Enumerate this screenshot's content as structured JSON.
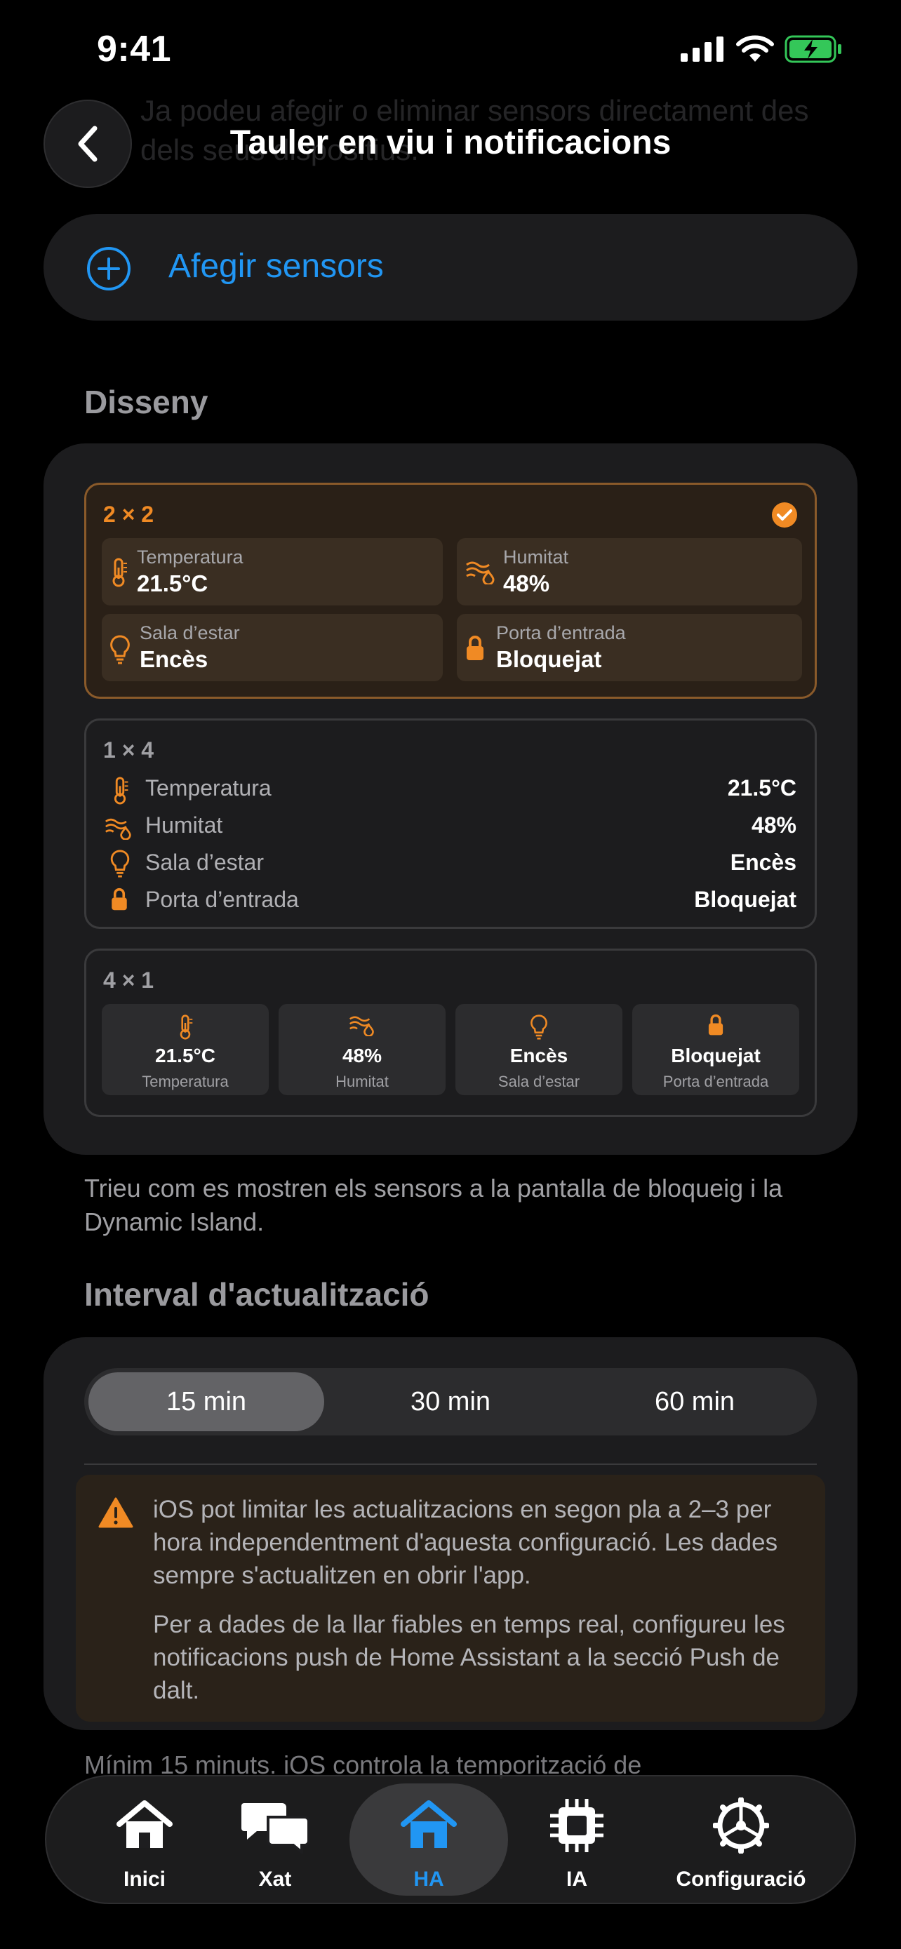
{
  "status_bar": {
    "time": "9:41"
  },
  "ghost_text": {
    "line1": "Ja podeu afegir o eliminar sensors directament des",
    "line2": "dels seus dispositius."
  },
  "header": {
    "title": "Tauler en viu i notificacions"
  },
  "add_sensors": {
    "label": "Afegir sensors"
  },
  "design": {
    "heading": "Disseny",
    "options": [
      {
        "title": "2 × 2",
        "selected": true
      },
      {
        "title": "1 × 4",
        "selected": false
      },
      {
        "title": "4 × 1",
        "selected": false
      }
    ],
    "sensors": [
      {
        "label": "Temperatura",
        "value": "21.5°C",
        "icon": "thermometer-icon"
      },
      {
        "label": "Humitat",
        "value": "48%",
        "icon": "humidity-icon"
      },
      {
        "label": "Sala d’estar",
        "value": "Encès",
        "icon": "lightbulb-icon"
      },
      {
        "label": "Porta d’entrada",
        "value": "Bloquejat",
        "icon": "lock-icon"
      }
    ],
    "footer": "Trieu com es mostren els sensors a la pantalla de bloqueig i la Dynamic Island."
  },
  "interval": {
    "heading": "Interval d'actualització",
    "options": [
      "15 min",
      "30 min",
      "60 min"
    ],
    "selected": "15 min",
    "warning_1": "iOS pot limitar les actualitzacions en segon pla a 2–3 per hora independentment d'aquesta configuració. Les dades sempre s'actualitzen en obrir l'app.",
    "warning_2": "Per a dades de la llar fiables en temps real, configureu les notificacions push de Home Assistant a la secció Push de dalt.",
    "footer": "Mínim 15 minuts. iOS controla la temporització de"
  },
  "tabbar": {
    "items": [
      {
        "label": "Inici",
        "icon": "house-icon"
      },
      {
        "label": "Xat",
        "icon": "chat-bubbles-icon"
      },
      {
        "label": "HA",
        "icon": "home-assistant-icon"
      },
      {
        "label": "IA",
        "icon": "chip-icon"
      },
      {
        "label": "Configuració",
        "icon": "gear-icon"
      }
    ],
    "active": "HA"
  },
  "colors": {
    "accent": "#2196f3",
    "orange": "#f08a24",
    "selected_border": "#8a5a2a"
  }
}
